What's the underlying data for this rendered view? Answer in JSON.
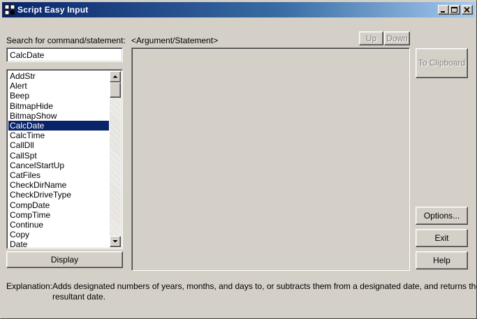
{
  "window": {
    "title": "Script Easy Input",
    "controls": [
      "minimize-icon",
      "maximize-icon",
      "close-icon"
    ]
  },
  "search": {
    "label": "Search for command/statement:",
    "value": "CalcDate"
  },
  "argument": {
    "label": "<Argument/Statement>",
    "up_label": "Up",
    "down_label": "Down"
  },
  "commands": {
    "items": [
      "AddStr",
      "Alert",
      "Beep",
      "BitmapHide",
      "BitmapShow",
      "CalcDate",
      "CalcTime",
      "CallDll",
      "CallSpt",
      "CancelStartUp",
      "CatFiles",
      "CheckDirName",
      "CheckDriveType",
      "CompDate",
      "CompTime",
      "Continue",
      "Copy",
      "Date"
    ],
    "selected": "CalcDate"
  },
  "buttons": {
    "display": "Display",
    "to_clipboard": "To Clipboard",
    "options": "Options...",
    "exit": "Exit",
    "help": "Help"
  },
  "explanation": {
    "label": "Explanation:",
    "line1": "Adds designated numbers of years, months, and days to, or subtracts them from a designated date, and returns the",
    "line2": "resultant date."
  },
  "colors": {
    "face": "#d4d0c8",
    "title_start": "#0a246a",
    "title_end": "#a6caf0",
    "selection": "#0a246a"
  }
}
